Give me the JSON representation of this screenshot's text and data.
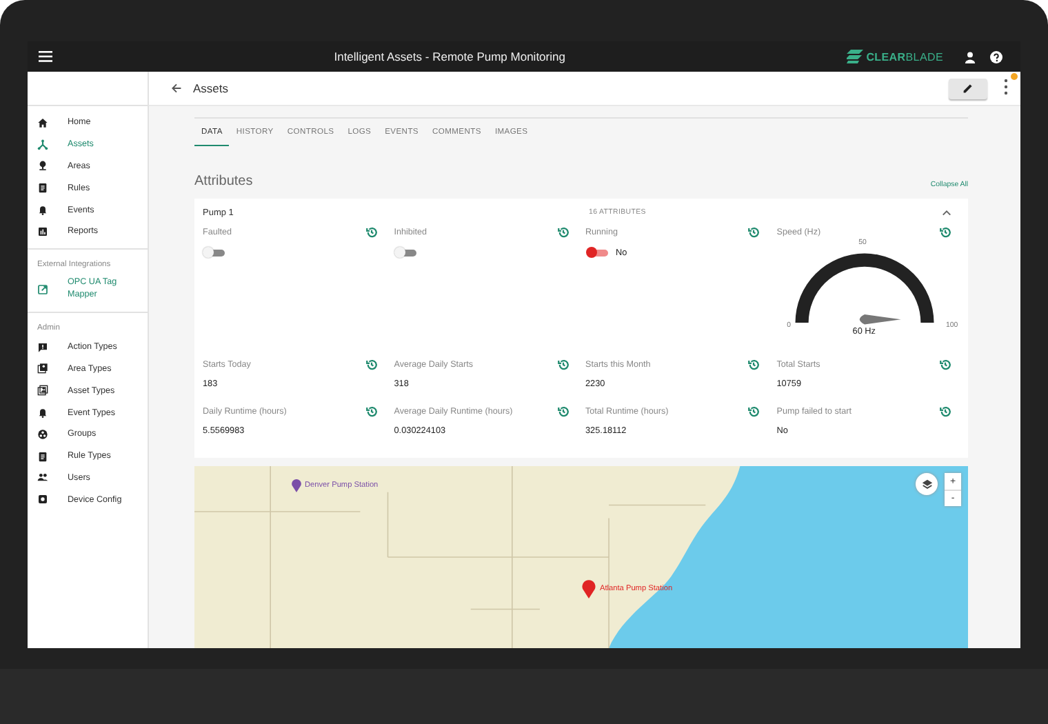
{
  "top_bar": {
    "title": "Intelligent Assets - Remote Pump Monitoring",
    "logo": "**CLEAR**BLADE"
  },
  "sidebar": {
    "items": [
      {
        "label": "Home",
        "selected": false
      },
      {
        "label": "Assets",
        "selected": true
      },
      {
        "label": "Areas",
        "selected": false
      },
      {
        "label": "Rules",
        "selected": false
      },
      {
        "label": "Events",
        "selected": false
      },
      {
        "label": "Reports",
        "selected": false
      }
    ],
    "integrations": {
      "heading": "External Integrations",
      "items": [
        {
          "label": "OPC UA Tag Mapper"
        }
      ]
    },
    "admin": {
      "heading": "Admin",
      "items": [
        {
          "label": "Action Types",
          "selected": false
        },
        {
          "label": "Area Types",
          "selected": false
        },
        {
          "label": "Asset Types",
          "selected": false
        },
        {
          "label": "Event Types",
          "selected": false
        },
        {
          "label": "Groups",
          "selected": false
        },
        {
          "label": "Rule Types",
          "selected": false
        },
        {
          "label": "Users",
          "selected": false
        },
        {
          "label": "Device Config",
          "selected": false
        }
      ]
    }
  },
  "header": {
    "title": "Assets",
    "notification": true
  },
  "tabs": [
    {
      "label": "DATA",
      "selected": true
    },
    {
      "label": "HISTORY",
      "selected": false
    },
    {
      "label": "CONTROLS",
      "selected": false
    },
    {
      "label": "LOGS",
      "selected": false
    },
    {
      "label": "EVENTS",
      "selected": false
    },
    {
      "label": "COMMENTS",
      "selected": false
    },
    {
      "label": "IMAGES",
      "selected": false
    }
  ],
  "attributes": {
    "heading": "Attributes",
    "collapse_link": "Collapse All",
    "card": {
      "title": "Pump 1",
      "count": "16 ATTRIBUTES",
      "expanded": true,
      "items": [
        {
          "kind": "toggle",
          "label": "Faulted",
          "on": false
        },
        {
          "kind": "toggle",
          "label": "Inhibited",
          "on": false
        },
        {
          "kind": "toggle",
          "label": "Running",
          "on": true,
          "value": "No"
        },
        {
          "kind": "gauge",
          "label": "Speed (Hz)",
          "min": "0",
          "mid": "50",
          "max": "100",
          "reading": "60 Hz"
        },
        {
          "kind": "value",
          "label": "Starts Today",
          "value": "183"
        },
        {
          "kind": "value",
          "label": "Average Daily Starts",
          "value": "318"
        },
        {
          "kind": "value",
          "label": "Starts this Month",
          "value": "2230"
        },
        {
          "kind": "value",
          "label": "Total Starts",
          "value": "10759"
        },
        {
          "kind": "value",
          "label": "Daily Runtime (hours)",
          "value": "5.5569983"
        },
        {
          "kind": "value",
          "label": "Average Daily Runtime (hours)",
          "value": "0.030224103"
        },
        {
          "kind": "value",
          "label": "Total Runtime (hours)",
          "value": "325.18112"
        },
        {
          "kind": "value",
          "label": "Pump failed to start",
          "value": "No"
        }
      ]
    }
  },
  "map": {
    "markers": [
      {
        "label": "Denver Pump Station",
        "color": "#7b4fa8",
        "selected": false
      },
      {
        "label": "Atlanta Pump Station",
        "color": "#e02424",
        "selected": true
      }
    ],
    "zoom_in": "+",
    "zoom_out": "-"
  }
}
